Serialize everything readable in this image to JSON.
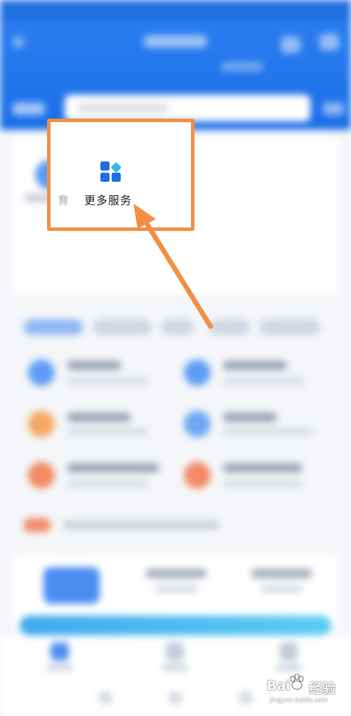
{
  "highlight": {
    "service_label": "更多服务",
    "partial_label": "育",
    "service_icon": "grid-apps-icon"
  },
  "colors": {
    "header_blue": "#1f6fe0",
    "highlight_orange": "#f28f45",
    "icon_blue": "#1f6fe0",
    "icon_teal": "#3bb5ee"
  },
  "watermark": {
    "brand_left": "Bai",
    "brand_right": "经验",
    "url": "jingyan.baidu.com"
  }
}
